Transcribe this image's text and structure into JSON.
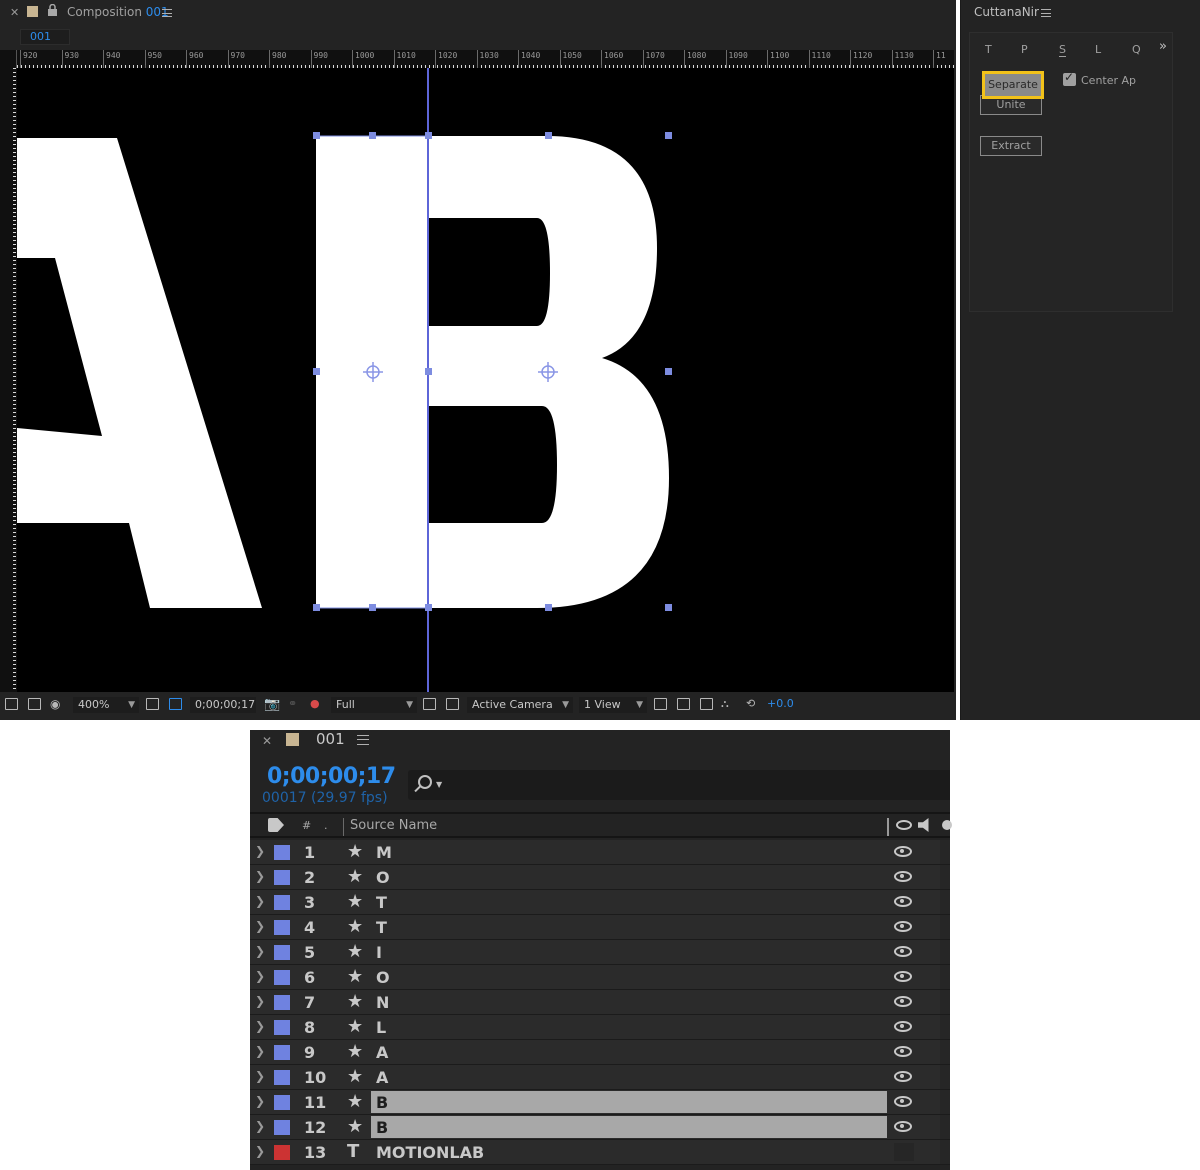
{
  "composition": {
    "tab_title_prefix": "Composition",
    "tab_title_number": "001",
    "subtab": "001",
    "ruler_marks": [
      "920",
      "930",
      "940",
      "950",
      "960",
      "970",
      "980",
      "990",
      "1000",
      "1010",
      "1020",
      "1030",
      "1040",
      "1050",
      "1060",
      "1070",
      "1080",
      "1090",
      "1100",
      "1110",
      "1120",
      "1130",
      "11"
    ],
    "canvas_letters": [
      "A",
      "B"
    ],
    "toolbar": {
      "zoom": "400%",
      "timecode": "0;00;00;17",
      "resolution": "Full",
      "camera": "Active Camera",
      "views": "1 View",
      "exposure": "+0.0"
    }
  },
  "cuttana": {
    "title": "CuttanaNir",
    "tabs": [
      "T",
      "P",
      "S",
      "L",
      "Q"
    ],
    "more": "»",
    "buttons": {
      "separate": "Separate",
      "unite": "Unite",
      "extract": "Extract"
    },
    "center_checkbox": "Center Ap"
  },
  "timeline": {
    "title": "001",
    "current_time": "0;00;00;17",
    "frame_info": "00017 (29.97 fps)",
    "columns": {
      "hash": "#",
      "source_name": "Source Name"
    },
    "layers": [
      {
        "num": "1",
        "type": "★",
        "name": "M",
        "color": "#6f82e0",
        "selected": false
      },
      {
        "num": "2",
        "type": "★",
        "name": "O",
        "color": "#6f82e0",
        "selected": false
      },
      {
        "num": "3",
        "type": "★",
        "name": "T",
        "color": "#6f82e0",
        "selected": false
      },
      {
        "num": "4",
        "type": "★",
        "name": "T",
        "color": "#6f82e0",
        "selected": false
      },
      {
        "num": "5",
        "type": "★",
        "name": "I",
        "color": "#6f82e0",
        "selected": false
      },
      {
        "num": "6",
        "type": "★",
        "name": "O",
        "color": "#6f82e0",
        "selected": false
      },
      {
        "num": "7",
        "type": "★",
        "name": "N",
        "color": "#6f82e0",
        "selected": false
      },
      {
        "num": "8",
        "type": "★",
        "name": "L",
        "color": "#6f82e0",
        "selected": false
      },
      {
        "num": "9",
        "type": "★",
        "name": "A",
        "color": "#6f82e0",
        "selected": false
      },
      {
        "num": "10",
        "type": "★",
        "name": "A",
        "color": "#6f82e0",
        "selected": false
      },
      {
        "num": "11",
        "type": "★",
        "name": "B",
        "color": "#6f82e0",
        "selected": true
      },
      {
        "num": "12",
        "type": "★",
        "name": "B",
        "color": "#6f82e0",
        "selected": true
      },
      {
        "num": "13",
        "type": "T",
        "name": "MOTIONLAB",
        "color": "#cc3333",
        "selected": false
      }
    ]
  },
  "colors": {
    "accent_blue": "#2d8ceb",
    "highlight_yellow": "#f2c21a",
    "layer_blue": "#6f82e0",
    "layer_red": "#cc3333",
    "handle": "#7d8ce0"
  }
}
